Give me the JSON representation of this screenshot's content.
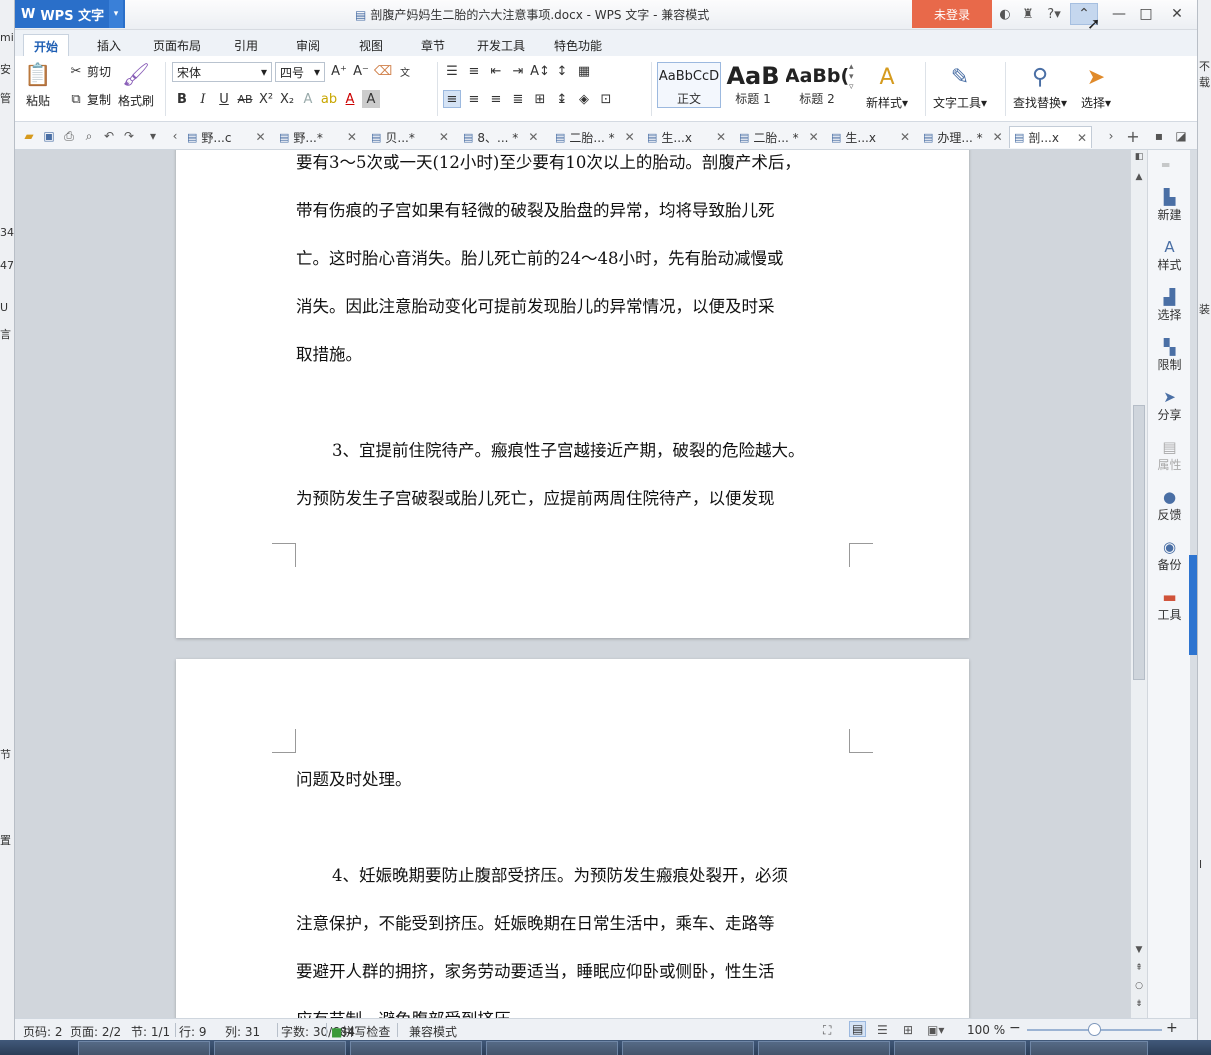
{
  "app": {
    "name": "WPS 文字",
    "doc_title": "剖腹产妈妈生二胎的六大注意事项.docx - WPS 文字 - 兼容模式",
    "login_label": "未登录",
    "help_label": "?"
  },
  "menu": {
    "tabs": [
      "开始",
      "插入",
      "页面布局",
      "引用",
      "审阅",
      "视图",
      "章节",
      "开发工具",
      "特色功能"
    ],
    "active": "开始"
  },
  "ribbon": {
    "paste": "粘贴",
    "cut": "剪切",
    "copy": "复制",
    "format_painter": "格式刷",
    "font_name": "宋体",
    "font_size": "四号",
    "styles": [
      {
        "sample": "AaBbCcD",
        "name": "正文"
      },
      {
        "sample": "AaB",
        "name": "标题 1"
      },
      {
        "sample": "AaBb(",
        "name": "标题 2"
      }
    ],
    "new_style": "新样式",
    "text_tools": "文字工具",
    "find_replace": "查找替换",
    "select": "选择"
  },
  "doctabs": [
    {
      "label": "野...c",
      "active": false
    },
    {
      "label": "野...*",
      "active": false
    },
    {
      "label": "贝...*",
      "active": false
    },
    {
      "label": "8、... *",
      "active": false
    },
    {
      "label": "二胎... *",
      "active": false
    },
    {
      "label": "生...x",
      "active": false
    },
    {
      "label": "二胎... *",
      "active": false
    },
    {
      "label": "生...x",
      "active": false
    },
    {
      "label": "办理... *",
      "active": false
    },
    {
      "label": "剖...x",
      "active": true
    }
  ],
  "document": {
    "page1_lines": [
      "要有3～5次或一天(12小时)至少要有10次以上的胎动。剖腹产术后，",
      "带有伤痕的子宫如果有轻微的破裂及胎盘的异常，均将导致胎儿死",
      "亡。这时胎心音消失。胎儿死亡前的24～48小时，先有胎动减慢或",
      "消失。因此注意胎动变化可提前发现胎儿的异常情况，以便及时采",
      "取措施。",
      "3、宜提前住院待产。瘢痕性子宫越接近产期，破裂的危险越大。",
      "为预防发生子宫破裂或胎儿死亡，应提前两周住院待产，以便发现"
    ],
    "page2_lines": [
      "问题及时处理。",
      "4、妊娠晚期要防止腹部受挤压。为预防发生瘢痕处裂开，必须",
      "注意保护，不能受到挤压。妊娠晚期在日常生活中，乘车、走路等",
      "要避开人群的拥挤，家务劳动要适当，睡眠应仰卧或侧卧，性生活",
      "应有节制，避免腹部受到挤压。"
    ]
  },
  "sidepanel": [
    {
      "label": "新建",
      "icon": "new-doc-icon",
      "enabled": true
    },
    {
      "label": "样式",
      "icon": "style-icon",
      "enabled": true
    },
    {
      "label": "选择",
      "icon": "select-icon",
      "enabled": true
    },
    {
      "label": "限制",
      "icon": "restrict-icon",
      "enabled": true
    },
    {
      "label": "分享",
      "icon": "share-icon",
      "enabled": true
    },
    {
      "label": "属性",
      "icon": "properties-icon",
      "enabled": false
    },
    {
      "label": "反馈",
      "icon": "feedback-icon",
      "enabled": true
    },
    {
      "label": "备份",
      "icon": "backup-icon",
      "enabled": true
    },
    {
      "label": "工具",
      "icon": "toolbox-icon",
      "enabled": true
    }
  ],
  "status": {
    "page_code": "页码: 2",
    "pages": "页面: 2/2",
    "section": "节: 1/1",
    "row": "行: 9",
    "col": "列: 31",
    "words": "字数: 30/684",
    "spell": "拼写检查",
    "compat": "兼容模式",
    "zoom": "100 %",
    "zoom_level": 0.5
  },
  "background_fragments": {
    "left": [
      "mi",
      "安",
      "管",
      "34",
      "47",
      "U",
      "言",
      "节",
      "置"
    ],
    "right": [
      "不载",
      "装",
      "l"
    ]
  },
  "colors": {
    "brand": "#2a6fc9",
    "login": "#e8694a",
    "accent": "#2d74d0"
  }
}
